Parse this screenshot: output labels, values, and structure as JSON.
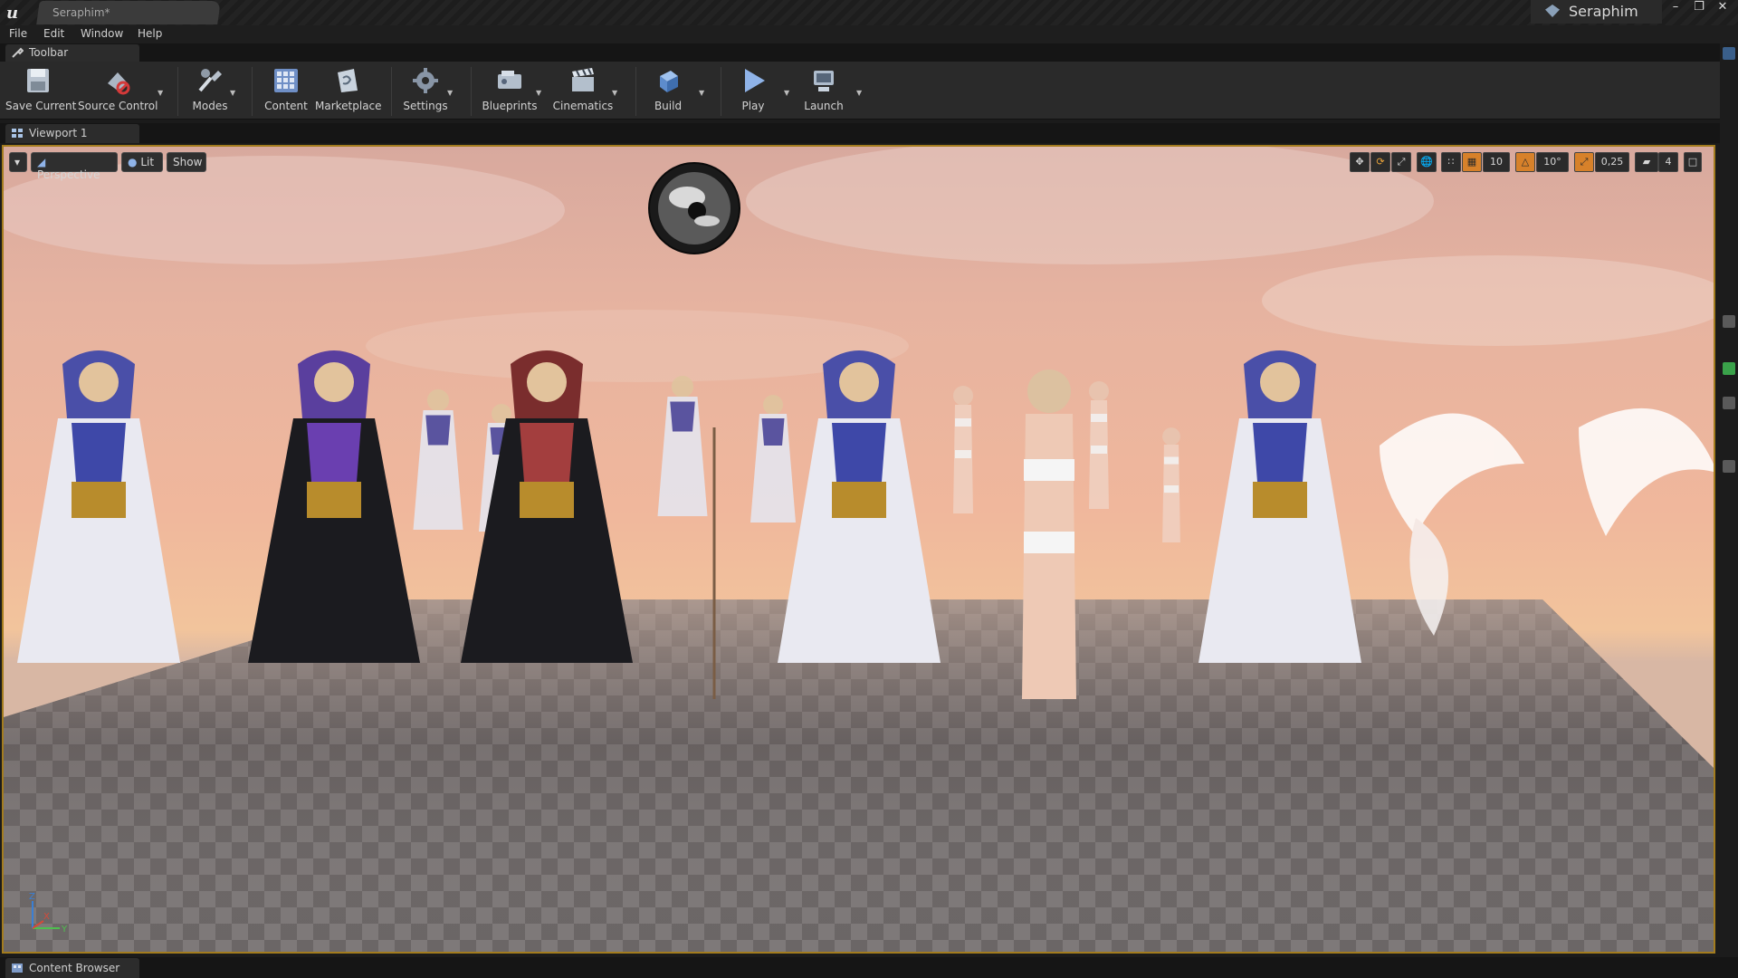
{
  "window": {
    "document_tab": "Seraphim*",
    "project_name": "Seraphim",
    "controls": [
      "minimize",
      "restore",
      "close"
    ]
  },
  "menu": [
    "File",
    "Edit",
    "Window",
    "Help"
  ],
  "toolbar_panel": {
    "tab_label": "Toolbar"
  },
  "toolbar": {
    "save_current": "Save Current",
    "source_control": "Source Control",
    "modes": "Modes",
    "content": "Content",
    "marketplace": "Marketplace",
    "settings": "Settings",
    "blueprints": "Blueprints",
    "cinematics": "Cinematics",
    "build": "Build",
    "play": "Play",
    "launch": "Launch"
  },
  "viewport_panel": {
    "tab_label": "Viewport 1"
  },
  "viewport": {
    "view_mode": "Perspective",
    "lighting_mode": "Lit",
    "show": "Show",
    "grid_snap": "10",
    "rotation_snap": "10°",
    "scale_snap": "0,25",
    "camera_speed": "4",
    "axis": {
      "x": "X",
      "y": "Y",
      "z": "Z"
    },
    "floor_pattern": "checkerboard",
    "sky_colors": [
      "#d8a99e",
      "#f0b79c",
      "#f2c49c"
    ]
  },
  "content_browser_panel": {
    "tab_label": "Content Browser"
  },
  "colors": {
    "accent": "#a37c1e",
    "background": "#1b1b1b",
    "panel": "#2a2a2a"
  }
}
